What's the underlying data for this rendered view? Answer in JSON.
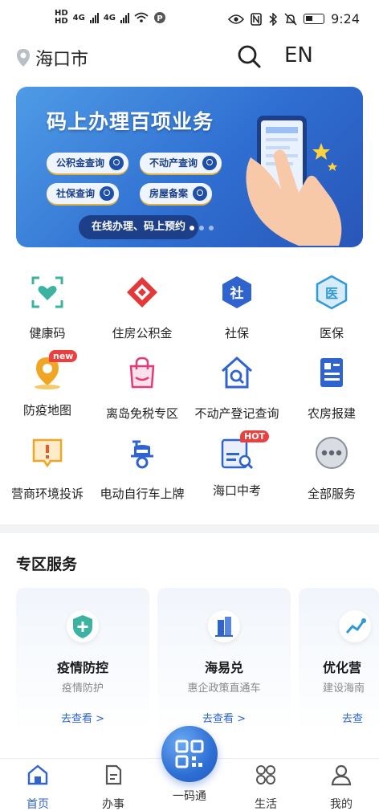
{
  "status_bar": {
    "sim_labels": [
      "HD",
      "HD"
    ],
    "net_labels": [
      "4G",
      "4G"
    ],
    "time": "9:24"
  },
  "header": {
    "city": "海口市",
    "lang_label": "EN"
  },
  "banner": {
    "title": "码上办理百项业务",
    "chips": [
      "公积金查询",
      "不动产查询",
      "社保查询",
      "房屋备案"
    ],
    "slogan": "在线办理、码上预约",
    "page_indicator": {
      "count": 3,
      "active": 0
    }
  },
  "services": [
    {
      "label": "健康码",
      "icon": "health-code-icon",
      "color": "#3bb3a0"
    },
    {
      "label": "住房公积金",
      "icon": "housing-fund-icon",
      "color": "#e23a3a"
    },
    {
      "label": "社保",
      "icon": "social-security-icon",
      "color": "#2f63d0"
    },
    {
      "label": "医保",
      "icon": "medical-insurance-icon",
      "color": "#2f9ad6"
    },
    {
      "label": "防疫地图",
      "icon": "epidemic-map-icon",
      "color": "#f0a623",
      "badge": "new"
    },
    {
      "label": "离岛免税专区",
      "icon": "shopping-bag-icon",
      "color": "#e6397a"
    },
    {
      "label": "不动产登记查询",
      "icon": "property-search-icon",
      "color": "#2f63d0"
    },
    {
      "label": "农房报建",
      "icon": "rural-house-icon",
      "color": "#2f63d0"
    },
    {
      "label": "营商环境投诉",
      "icon": "complaint-icon",
      "color": "#f0a623"
    },
    {
      "label": "电动自行车上牌",
      "icon": "scooter-icon",
      "color": "#2f63d0"
    },
    {
      "label": "海口中考",
      "icon": "exam-icon",
      "color": "#2f63d0",
      "badge": "HOT"
    },
    {
      "label": "全部服务",
      "icon": "more-icon",
      "color": "#8a8f99"
    }
  ],
  "zone": {
    "title": "专区服务",
    "cards": [
      {
        "title": "疫情防控",
        "subtitle": "疫情防护",
        "link": "去查看 >",
        "icon": "shield-plus-icon",
        "color": "#3bb3a0"
      },
      {
        "title": "海易兑",
        "subtitle": "惠企政策直通车",
        "link": "去查看 >",
        "icon": "building-icon",
        "color": "#2f63d0"
      },
      {
        "title": "优化营",
        "subtitle": "建设海南",
        "link": "去查",
        "icon": "chart-icon",
        "color": "#2f9ad6"
      }
    ]
  },
  "tabbar": {
    "tabs": [
      {
        "label": "首页",
        "icon": "home-icon",
        "active": true
      },
      {
        "label": "办事",
        "icon": "document-icon",
        "active": false
      },
      {
        "label": "一码通",
        "icon": "qr-code-icon",
        "active": false
      },
      {
        "label": "生活",
        "icon": "apps-icon",
        "active": false
      },
      {
        "label": "我的",
        "icon": "person-icon",
        "active": false
      }
    ]
  },
  "colors": {
    "accent": "#2f63d0",
    "banner": "#3a7fdc"
  }
}
